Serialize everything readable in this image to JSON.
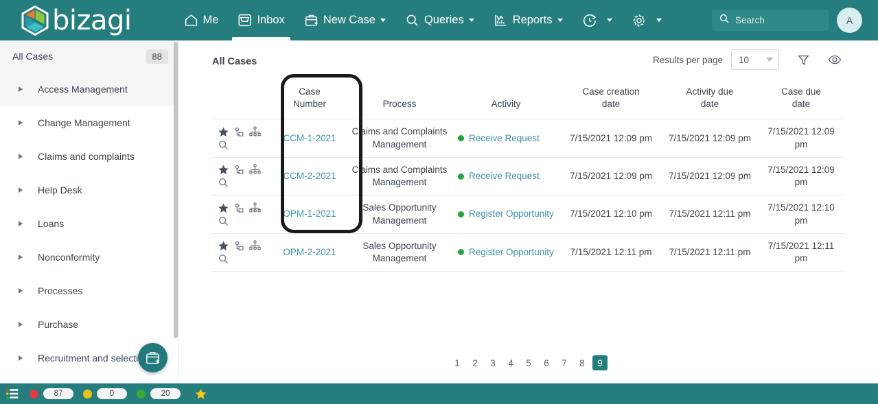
{
  "brand": {
    "name": "bizagi",
    "logo_icon": "bizagi-hexagon-logo",
    "primary_color": "#257d7d",
    "link_color": "#3e8fa8",
    "status_green": "#22a33f"
  },
  "topnav": {
    "items": [
      {
        "label": "Me",
        "icon": "home-icon",
        "active": false,
        "caret": false
      },
      {
        "label": "Inbox",
        "icon": "inbox-icon",
        "active": true,
        "caret": false
      },
      {
        "label": "New Case",
        "icon": "new-case-icon",
        "active": false,
        "caret": true
      },
      {
        "label": "Queries",
        "icon": "search-icon",
        "active": false,
        "caret": true
      },
      {
        "label": "Reports",
        "icon": "reports-chart-icon",
        "active": false,
        "caret": true
      },
      {
        "label": "",
        "icon": "stopwatch-icon",
        "active": false,
        "caret": true
      },
      {
        "label": "",
        "icon": "gear-icon",
        "active": false,
        "caret": true
      }
    ],
    "search": {
      "placeholder": "Search",
      "icon": "search-icon"
    },
    "avatar": {
      "initial": "A"
    }
  },
  "sidebar": {
    "header": {
      "title": "All Cases",
      "count": "88"
    },
    "items": [
      {
        "label": "Access Management",
        "highlighted": true
      },
      {
        "label": "Change Management",
        "highlighted": false
      },
      {
        "label": "Claims and complaints",
        "highlighted": false
      },
      {
        "label": "Help Desk",
        "highlighted": false
      },
      {
        "label": "Loans",
        "highlighted": false
      },
      {
        "label": "Nonconformity",
        "highlighted": false
      },
      {
        "label": "Processes",
        "highlighted": false
      },
      {
        "label": "Purchase",
        "highlighted": false
      },
      {
        "label": "Recruitment and selection",
        "highlighted": false
      }
    ],
    "fab": {
      "icon": "new-case-briefcase-plus-icon"
    }
  },
  "main": {
    "title": "All Cases",
    "toolbar": {
      "results_per_page_label": "Results per page",
      "results_per_page_value": "10",
      "filter_icon": "funnel-filter-icon",
      "view_icon": "eye-visibility-icon"
    },
    "table": {
      "columns": [
        {
          "label": "",
          "name": "row-actions"
        },
        {
          "label": "Case\nNumber",
          "name": "case-number",
          "line1": "Case",
          "line2": "Number"
        },
        {
          "label": "Process",
          "name": "process",
          "line1": "Process",
          "line2": ""
        },
        {
          "label": "Activity",
          "name": "activity",
          "line1": "Activity",
          "line2": ""
        },
        {
          "label": "Case creation date",
          "name": "case-creation-date",
          "line1": "Case creation",
          "line2": "date"
        },
        {
          "label": "Activity due date",
          "name": "activity-due-date",
          "line1": "Activity due",
          "line2": "date"
        },
        {
          "label": "Case due date",
          "name": "case-due-date",
          "line1": "Case due",
          "line2": "date"
        }
      ],
      "row_icons": [
        "star-icon",
        "related-cases-icon",
        "process-diagram-icon",
        "magnifier-search-icon"
      ],
      "rows": [
        {
          "case_number": "CCM-1-2021",
          "process_line1": "Claims and Complaints",
          "process_line2": "Management",
          "activity": "Receive Request",
          "activity_status": "green",
          "case_creation_date": "7/15/2021 12:09 pm",
          "activity_due_date": "7/15/2021 12:09 pm",
          "case_due_date": "7/15/2021 12:09 pm"
        },
        {
          "case_number": "CCM-2-2021",
          "process_line1": "Claims and Complaints",
          "process_line2": "Management",
          "activity": "Receive Request",
          "activity_status": "green",
          "case_creation_date": "7/15/2021 12:09 pm",
          "activity_due_date": "7/15/2021 12:09 pm",
          "case_due_date": "7/15/2021 12:09 pm"
        },
        {
          "case_number": "OPM-1-2021",
          "process_line1": "Sales Opportunity",
          "process_line2": "Management",
          "activity": "Register Opportunity",
          "activity_status": "green",
          "case_creation_date": "7/15/2021 12:10 pm",
          "activity_due_date": "7/15/2021 12:11 pm",
          "case_due_date": "7/15/2021 12:10 pm"
        },
        {
          "case_number": "OPM-2-2021",
          "process_line1": "Sales Opportunity",
          "process_line2": "Management",
          "activity": "Register Opportunity",
          "activity_status": "green",
          "case_creation_date": "7/15/2021 12:11 pm",
          "activity_due_date": "7/15/2021 12:11 pm",
          "case_due_date": "7/15/2021 12:11 pm"
        }
      ]
    },
    "pagination": {
      "pages": [
        "1",
        "2",
        "3",
        "4",
        "5",
        "6",
        "7",
        "8",
        "9"
      ],
      "active": "9"
    }
  },
  "bottombar": {
    "menu_icon": "list-menu-icon",
    "stats": [
      {
        "color": "#e0393e",
        "value": "87",
        "name": "overdue-count"
      },
      {
        "color": "#e8c217",
        "value": "0",
        "name": "at-risk-count"
      },
      {
        "color": "#3aa935",
        "value": "20",
        "name": "on-time-count"
      }
    ],
    "star_icon": "favorites-star-icon"
  },
  "annotation": {
    "highlight_target": "case-number-column",
    "border_color": "#1a1a1a"
  }
}
